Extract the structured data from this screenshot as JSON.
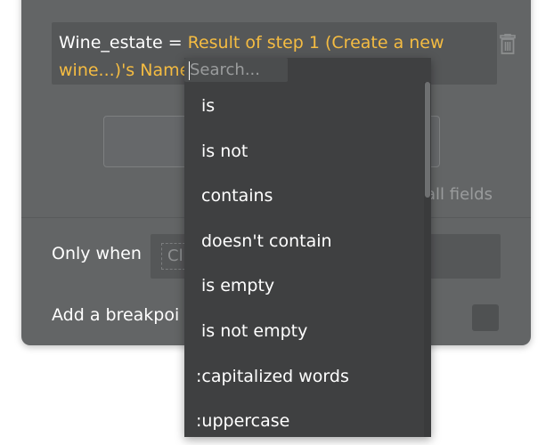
{
  "expression": {
    "field": "Wine_estate",
    "operator": "=",
    "value": "Result of step 1 (Create a new wine...)'s Name"
  },
  "trash_icon": "trash-icon",
  "all_fields_text": "all fields",
  "only_when": {
    "label": "Only when",
    "placeholder": "Cl"
  },
  "breakpoint": {
    "label": "Add a breakpoi"
  },
  "dropdown": {
    "search_placeholder": "Search...",
    "options": [
      "is",
      "is not",
      "contains",
      "doesn't contain",
      "is empty",
      "is not empty",
      ":capitalized words",
      ":uppercase"
    ]
  },
  "colors": {
    "panel": "#636566",
    "field_bg": "#555758",
    "dropdown_bg": "#3f4041",
    "value_text": "#f5bc42"
  }
}
